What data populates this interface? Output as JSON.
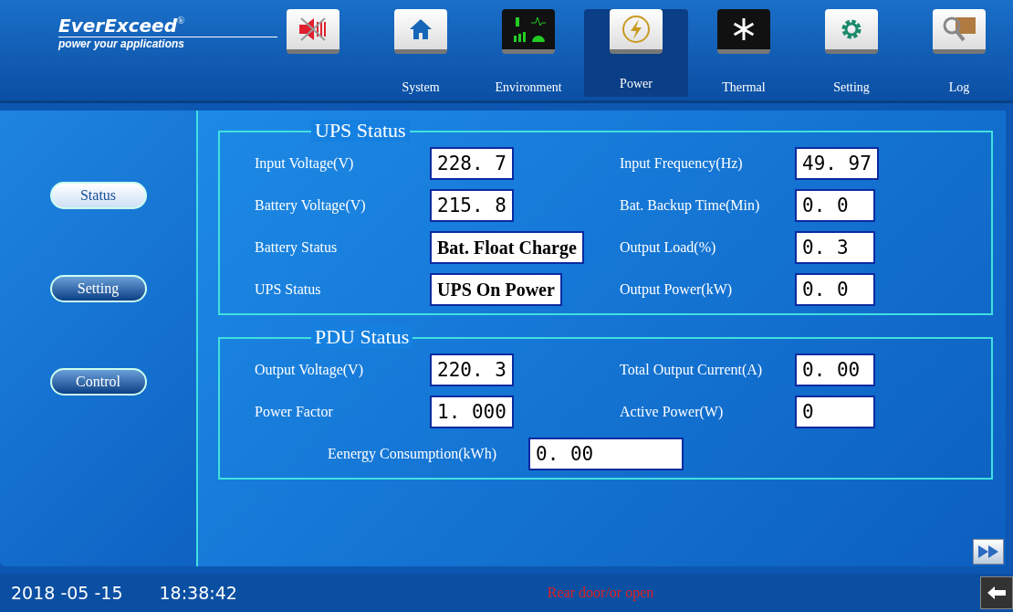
{
  "logo": {
    "brand": "EverExceed",
    "registered": "®",
    "tagline": "power your applications"
  },
  "nav": [
    {
      "kind": "mute",
      "selected": false
    },
    {
      "kind": "home",
      "label": "System",
      "selected": false
    },
    {
      "kind": "environment",
      "label": "Environment",
      "selected": false
    },
    {
      "kind": "power",
      "label": "Power",
      "selected": true
    },
    {
      "kind": "thermal",
      "label": "Thermal",
      "selected": false
    },
    {
      "kind": "setting",
      "label": "Setting",
      "selected": false
    },
    {
      "kind": "log",
      "label": "Log",
      "selected": false
    }
  ],
  "sidebar": {
    "items": [
      {
        "label": "Status",
        "selected": true
      },
      {
        "label": "Setting",
        "selected": false
      },
      {
        "label": "Control",
        "selected": false
      }
    ]
  },
  "panels": [
    {
      "title": "UPS Status",
      "rows": [
        [
          {
            "label": "Input Voltage(V)",
            "value": "228. 7"
          },
          {
            "label": "Input Frequency(Hz)",
            "value": "49. 97"
          }
        ],
        [
          {
            "label": "Battery Voltage(V)",
            "value": "215. 8"
          },
          {
            "label": "Bat. Backup Time(Min)",
            "value": "0. 0"
          }
        ],
        [
          {
            "label": "Battery Status",
            "value": "Bat. Float Charge"
          },
          {
            "label": "Output Load(%)",
            "value": "0. 3"
          }
        ],
        [
          {
            "label": "UPS Status",
            "value": "UPS On Power"
          },
          {
            "label": "Output Power(kW)",
            "value": "0. 0"
          }
        ]
      ]
    },
    {
      "title": "PDU Status",
      "rows": [
        [
          {
            "label": "Output Voltage(V)",
            "value": "220. 3"
          },
          {
            "label": "Total Output Current(A)",
            "value": "0. 00"
          }
        ],
        [
          {
            "label": "Power Factor",
            "value": "1. 000"
          },
          {
            "label": "Active Power(W)",
            "value": "0"
          }
        ],
        [
          {
            "label": "Eenergy Consumption(kWh)",
            "value": "0. 00"
          }
        ]
      ]
    }
  ],
  "status_bar": {
    "date": "2018 -05 -15",
    "time": "18:38:42",
    "alarm": "Rear door/or open"
  }
}
